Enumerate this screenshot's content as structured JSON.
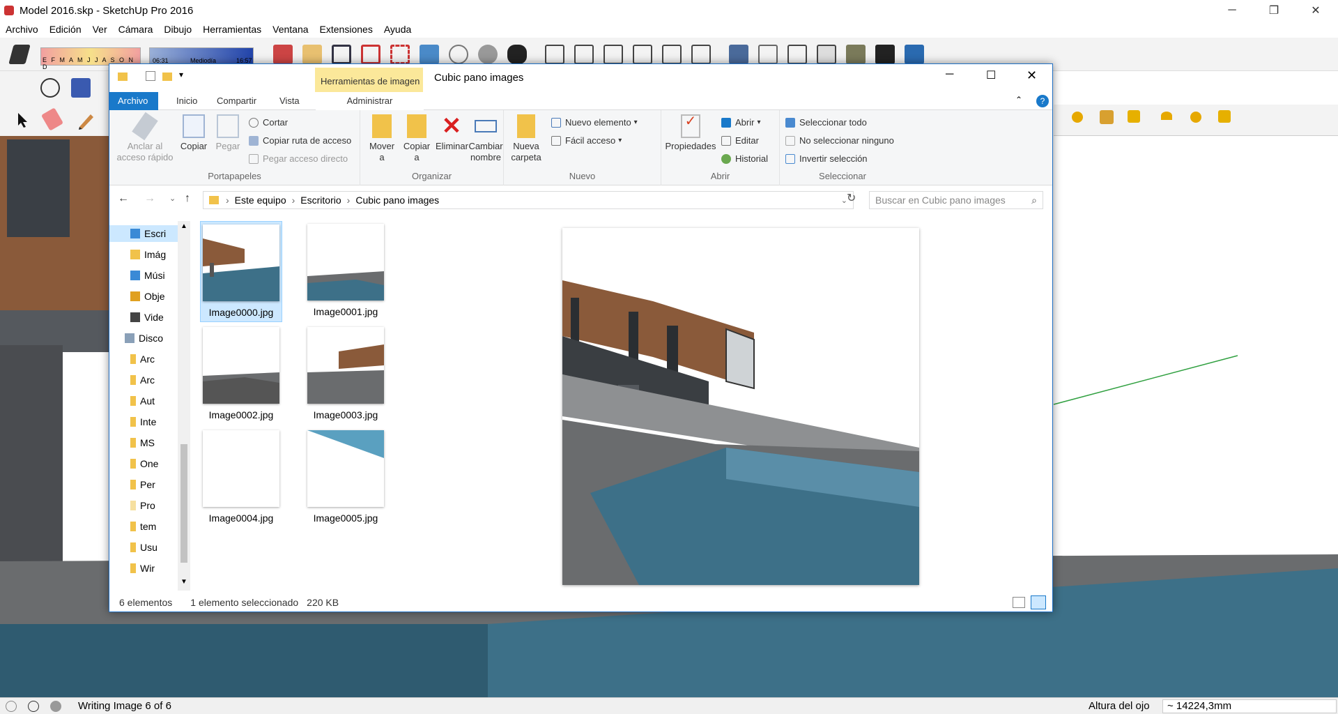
{
  "sketchup": {
    "title": "Model 2016.skp - SketchUp Pro 2016",
    "menu": [
      "Archivo",
      "Edición",
      "Ver",
      "Cámara",
      "Dibujo",
      "Herramientas",
      "Ventana",
      "Extensiones",
      "Ayuda"
    ],
    "shadow_months": "E F M A M J J A S O N D",
    "time_start": "06:31",
    "time_mid": "Mediodía",
    "time_end": "16:57",
    "status_text": "Writing Image 6 of 6",
    "status_label": "Altura del ojo",
    "status_value": "~ 14224,3mm"
  },
  "explorer": {
    "title": "Cubic pano images",
    "context_tab": "Herramientas de imagen",
    "tabs": [
      "Archivo",
      "Inicio",
      "Compartir",
      "Vista",
      "Administrar"
    ],
    "ribbon": {
      "portapapeles": {
        "label": "Portapapeles",
        "anclar": "Anclar al acceso rápido",
        "copiar": "Copiar",
        "pegar": "Pegar",
        "cortar": "Cortar",
        "copiar_ruta": "Copiar ruta de acceso",
        "pegar_acceso": "Pegar acceso directo"
      },
      "organizar": {
        "label": "Organizar",
        "mover": "Mover a",
        "copiar": "Copiar a",
        "eliminar": "Eliminar",
        "cambiar": "Cambiar nombre"
      },
      "nuevo": {
        "label": "Nuevo",
        "nueva_carpeta": "Nueva carpeta",
        "nuevo_elemento": "Nuevo elemento",
        "facil_acceso": "Fácil acceso"
      },
      "abrir": {
        "label": "Abrir",
        "propiedades": "Propiedades",
        "abrir": "Abrir",
        "editar": "Editar",
        "historial": "Historial"
      },
      "seleccionar": {
        "label": "Seleccionar",
        "todo": "Seleccionar todo",
        "ninguno": "No seleccionar ninguno",
        "invertir": "Invertir selección"
      }
    },
    "breadcrumb": [
      "Este equipo",
      "Escritorio",
      "Cubic pano images"
    ],
    "search_placeholder": "Buscar en Cubic pano images",
    "nav_items": [
      "Escri",
      "Imág",
      "Músi",
      "Obje",
      "Vide",
      "Disco",
      "Arc",
      "Arc",
      "Aut",
      "Inte",
      "MS",
      "One",
      "Per",
      "Pro",
      "tem",
      "Usu",
      "Wir"
    ],
    "files": [
      "Image0000.jpg",
      "Image0001.jpg",
      "Image0002.jpg",
      "Image0003.jpg",
      "Image0004.jpg",
      "Image0005.jpg"
    ],
    "selected_file": "Image0000.jpg",
    "status_count": "6 elementos",
    "status_selected": "1 elemento seleccionado",
    "status_size": "220 KB"
  },
  "colors": {
    "accent": "#1979ca",
    "context_tab": "#fbe89a",
    "selection": "#cce8ff",
    "brick": "#8a5a3a",
    "water": "#3d7088"
  }
}
